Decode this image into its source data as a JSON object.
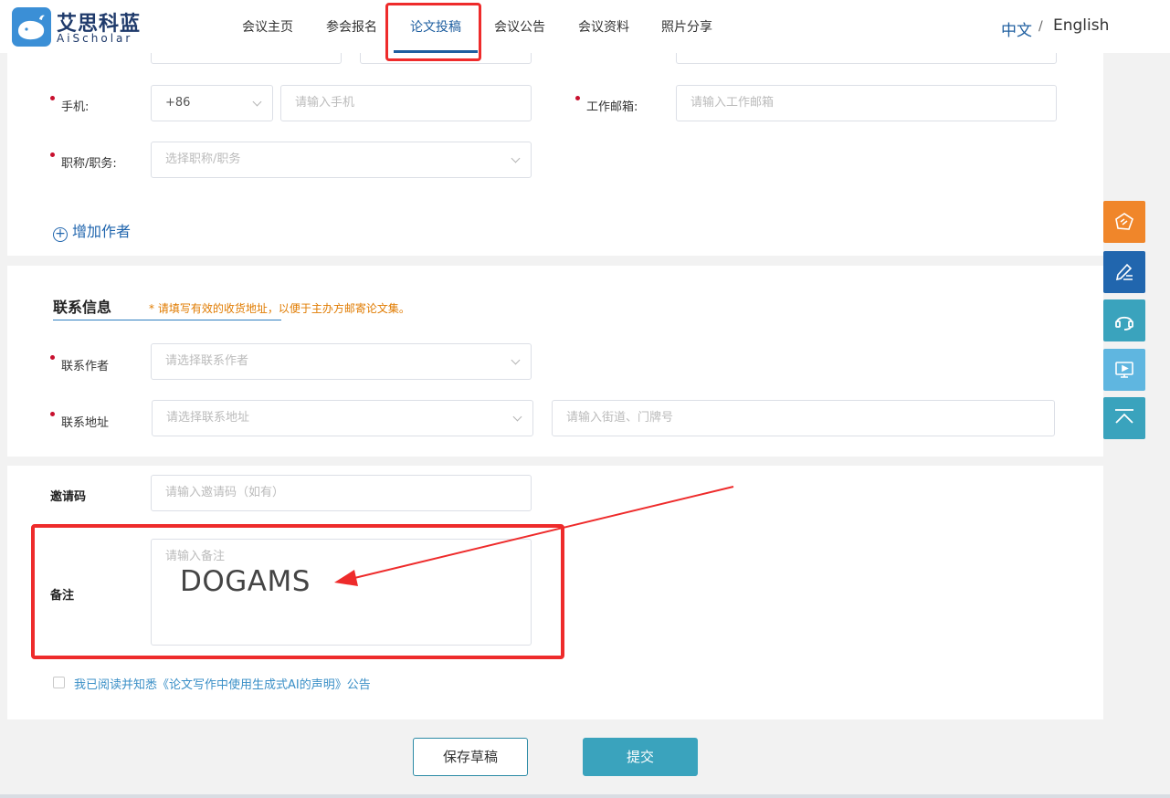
{
  "header": {
    "logo_title": "艾思科蓝",
    "logo_sub": "AiScholar",
    "nav": [
      "会议主页",
      "参会报名",
      "论文投稿",
      "会议公告",
      "会议资料",
      "照片分享"
    ],
    "active_index": 2,
    "lang_zh": "中文",
    "lang_sep": "/",
    "lang_en": "English"
  },
  "author": {
    "phone_label": "手机:",
    "phone_code": "+86",
    "phone_placeholder": "请输入手机",
    "email_label": "工作邮箱:",
    "email_placeholder": "请输入工作邮箱",
    "title_label": "职称/职务:",
    "title_placeholder": "选择职称/职务",
    "add_author": "增加作者"
  },
  "contact": {
    "section_title": "联系信息",
    "note": "* 请填写有效的收货地址，以便于主办方邮寄论文集。",
    "contact_author_label": "联系作者",
    "contact_author_placeholder": "请选择联系作者",
    "address_label": "联系地址",
    "address_placeholder": "请选择联系地址",
    "street_placeholder": "请输入街道、门牌号"
  },
  "extra": {
    "invite_label": "邀请码",
    "invite_placeholder": "请输入邀请码（如有）",
    "remark_label": "备注",
    "remark_placeholder": "请输入备注",
    "remark_value": "DOGAMS",
    "agree_text": "我已阅读并知悉《论文写作中使用生成式AI的声明》公告"
  },
  "actions": {
    "save_draft": "保存草稿",
    "submit": "提交"
  },
  "float_buttons": [
    "ticket-icon",
    "edit-icon",
    "headset-icon",
    "presentation-icon",
    "back-to-top-icon"
  ],
  "colors": {
    "primary": "#1f5fa0",
    "submit": "#3aa3bd",
    "annotation": "#ee2b2b",
    "note": "#e07b00"
  }
}
